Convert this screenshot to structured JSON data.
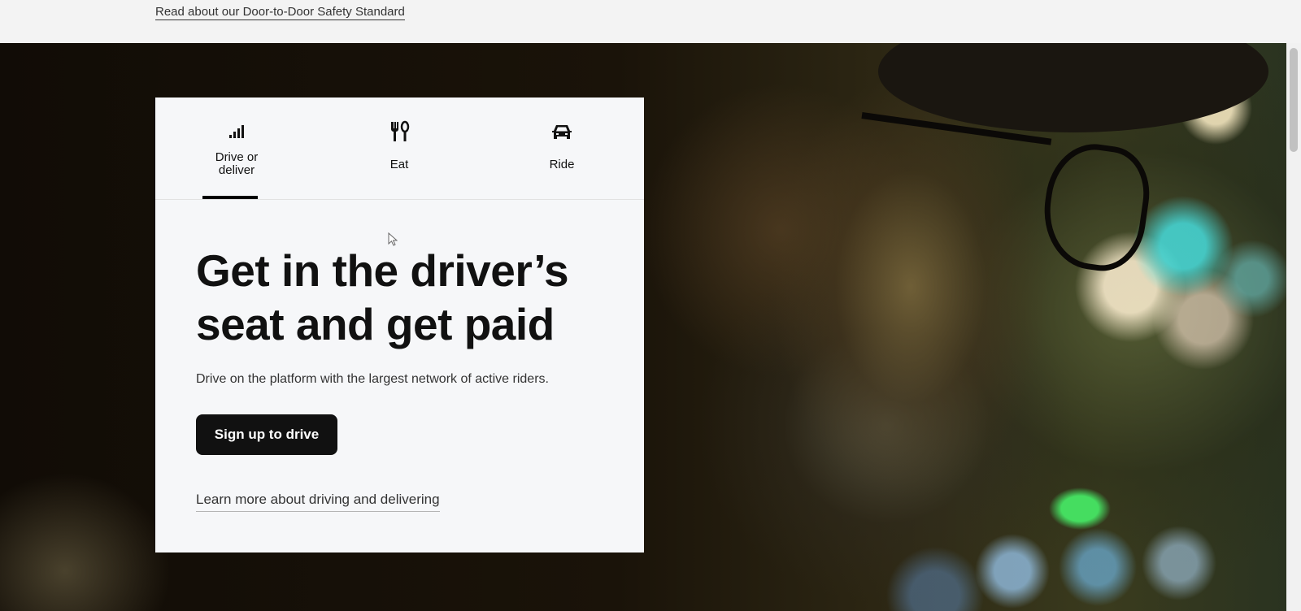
{
  "announcement": {
    "link_text": "Read about our Door-to-Door Safety Standard"
  },
  "hero": {
    "image_alt": "Driver with glasses at night"
  },
  "tabs": [
    {
      "label_line1": "Drive or",
      "label_line2": "deliver",
      "icon": "bars-icon",
      "selected": true
    },
    {
      "label": "Eat",
      "icon": "fork-knife-icon",
      "selected": false
    },
    {
      "label": "Ride",
      "icon": "car-icon",
      "selected": false
    }
  ],
  "content": {
    "headline_line1": "Get in the driver’s",
    "headline_line2": "seat and get paid",
    "subtext": "Drive on the platform with the largest network of active riders.",
    "cta_label": "Sign up to drive",
    "learn_more": "Learn more about driving and delivering"
  }
}
